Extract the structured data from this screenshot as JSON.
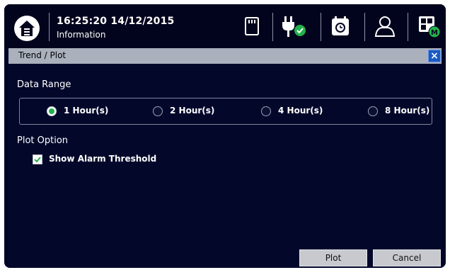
{
  "topbar": {
    "datetime": "16:25:20  14/12/2015",
    "screen_name": "Information",
    "icons": [
      "home-icon",
      "memory-card-icon",
      "power-plug-status-icon",
      "timer-icon",
      "user-icon",
      "module-icon"
    ],
    "module_badge": "M"
  },
  "dialog": {
    "title": "Trend / Plot",
    "close_label": "×",
    "data_range": {
      "label": "Data Range",
      "options": [
        "1 Hour(s)",
        "2 Hour(s)",
        "4 Hour(s)",
        "8 Hour(s)"
      ],
      "selected": "1 Hour(s)"
    },
    "plot_option": {
      "label": "Plot Option",
      "show_alarm_threshold": {
        "label": "Show Alarm Threshold",
        "checked": true
      }
    },
    "buttons": {
      "plot": "Plot",
      "cancel": "Cancel"
    }
  },
  "colors": {
    "background": "#020626",
    "titlebar": "#aab0bc",
    "accent_green": "#22b24c",
    "close_blue": "#1b5ac4",
    "button_gray": "#c7c9cf"
  }
}
